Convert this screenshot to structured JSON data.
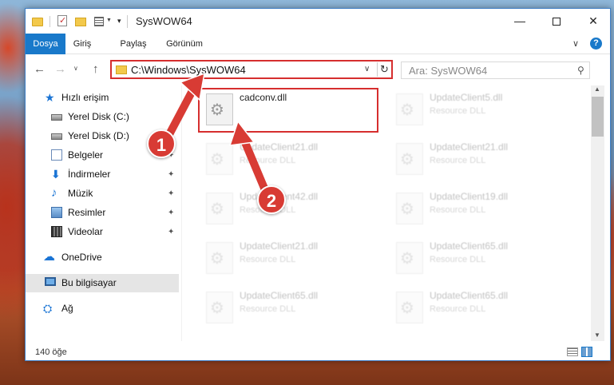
{
  "window": {
    "title": "SysWOW64",
    "minimize": "—",
    "close": "✕"
  },
  "ribbon": {
    "tabs": [
      "Dosya",
      "Giriş",
      "Paylaş",
      "Görünüm"
    ],
    "collapse": "∨",
    "help": "?"
  },
  "nav": {
    "back": "←",
    "forward": "→",
    "recent": "∨",
    "up": "↑",
    "address": "C:\\Windows\\SysWOW64",
    "address_dropdown": "∨",
    "refresh": "↻",
    "search_placeholder": "Ara: SysWOW64",
    "search_icon": "⚲"
  },
  "sidebar": {
    "items": [
      {
        "label": "Hızlı erişim",
        "icon": "star-icon"
      },
      {
        "label": "Yerel Disk (C:)",
        "icon": "drive-icon"
      },
      {
        "label": "Yerel Disk (D:)",
        "icon": "drive-icon"
      },
      {
        "label": "Belgeler",
        "icon": "documents-icon"
      },
      {
        "label": "İndirmeler",
        "icon": "downloads-icon"
      },
      {
        "label": "Müzik",
        "icon": "music-icon"
      },
      {
        "label": "Resimler",
        "icon": "pictures-icon"
      },
      {
        "label": "Videolar",
        "icon": "videos-icon"
      },
      {
        "label": "OneDrive",
        "icon": "cloud-icon"
      },
      {
        "label": "Bu bilgisayar",
        "icon": "pc-icon"
      },
      {
        "label": "Ağ",
        "icon": "network-icon"
      }
    ],
    "pin": "📌"
  },
  "files": [
    {
      "name": "cadconv.dll",
      "type": ""
    },
    {
      "name": "UpdateClient5.dll",
      "type": "Resource DLL"
    },
    {
      "name": "UpdateClient21.dll",
      "type": "Resource DLL"
    },
    {
      "name": "UpdateClient21.dll",
      "type": "Resource DLL"
    },
    {
      "name": "UpdateClient42.dll",
      "type": "Resource DLL"
    },
    {
      "name": "UpdateClient19.dll",
      "type": "Resource DLL"
    },
    {
      "name": "UpdateClient21.dll",
      "type": "Resource DLL"
    },
    {
      "name": "UpdateClient65.dll",
      "type": "Resource DLL"
    },
    {
      "name": "UpdateClient65.dll",
      "type": "Resource DLL"
    },
    {
      "name": "UpdateClient65.dll",
      "type": "Resource DLL"
    }
  ],
  "status": {
    "count": "140 öğe"
  },
  "annotations": {
    "step1": "1",
    "step2": "2",
    "accent": "#d62e2e"
  },
  "colors": {
    "ribbon_file_tab": "#1979ca",
    "window_border": "#3f7fc6"
  }
}
